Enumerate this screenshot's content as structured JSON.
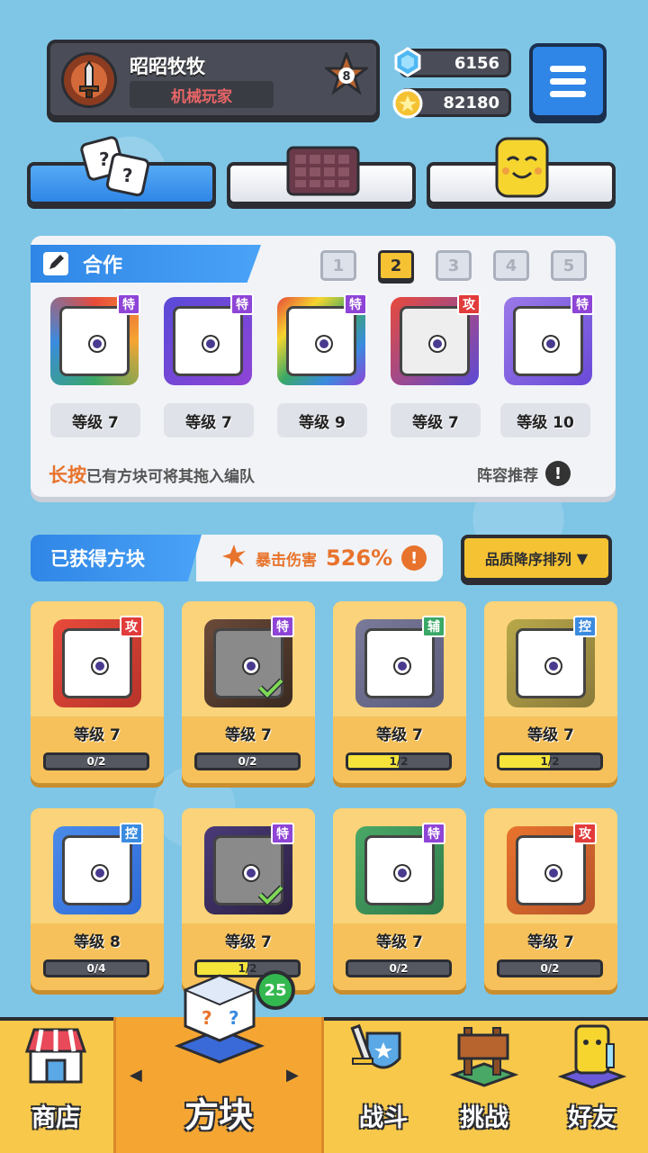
{
  "profile": {
    "name": "昭昭牧牧",
    "title": "机械玩家",
    "rank": "8"
  },
  "currency": {
    "gems": "6156",
    "coins": "82180"
  },
  "tabs": [
    {
      "name": "dice-tab",
      "active": true
    },
    {
      "name": "board-tab",
      "active": false
    },
    {
      "name": "emote-tab",
      "active": false
    }
  ],
  "team": {
    "title": "合作",
    "pages": [
      "1",
      "2",
      "3",
      "4",
      "5"
    ],
    "active_page": "2",
    "dice": [
      {
        "type": "特",
        "level": "等级 7"
      },
      {
        "type": "特",
        "level": "等级 7"
      },
      {
        "type": "特",
        "level": "等级 9"
      },
      {
        "type": "攻",
        "level": "等级 7"
      },
      {
        "type": "特",
        "level": "等级 10"
      }
    ],
    "hint_highlight": "长按",
    "hint_text": "已有方块可将其拖入编队",
    "recommend_label": "阵容推荐",
    "recommend_icon": "!"
  },
  "collection": {
    "title": "已获得方块",
    "crit_label": "暴击伤害",
    "crit_value": "526%",
    "crit_icon": "!",
    "sort_label": "品质降序排列",
    "sort_arrow": "▼",
    "cards": [
      {
        "type": "攻",
        "level": "等级 7",
        "progress": "0/2",
        "fill": 0
      },
      {
        "type": "特",
        "level": "等级 7",
        "progress": "0/2",
        "fill": 0
      },
      {
        "type": "辅",
        "level": "等级 7",
        "progress": "1/2",
        "fill": 0.5
      },
      {
        "type": "控",
        "level": "等级 7",
        "progress": "1/2",
        "fill": 0.5
      },
      {
        "type": "控",
        "level": "等级 8",
        "progress": "0/4",
        "fill": 0
      },
      {
        "type": "特",
        "level": "等级 7",
        "progress": "1/2",
        "fill": 0.5
      },
      {
        "type": "特",
        "level": "等级 7",
        "progress": "0/2",
        "fill": 0
      },
      {
        "type": "攻",
        "level": "等级 7",
        "progress": "0/2",
        "fill": 0
      }
    ]
  },
  "nav": {
    "shop": "商店",
    "dice": "方块",
    "battle": "战斗",
    "challenge": "挑战",
    "friends": "好友",
    "dice_badge": "25",
    "left_arrow": "◀",
    "right_arrow": "▶"
  },
  "colors": {
    "blue": "#2f86e6",
    "yellow": "#f5c233",
    "orange": "#e8732c",
    "badge_special": "#8e44d6",
    "badge_attack": "#e23b3b",
    "badge_support": "#3aa866",
    "badge_control": "#3a8be0"
  }
}
